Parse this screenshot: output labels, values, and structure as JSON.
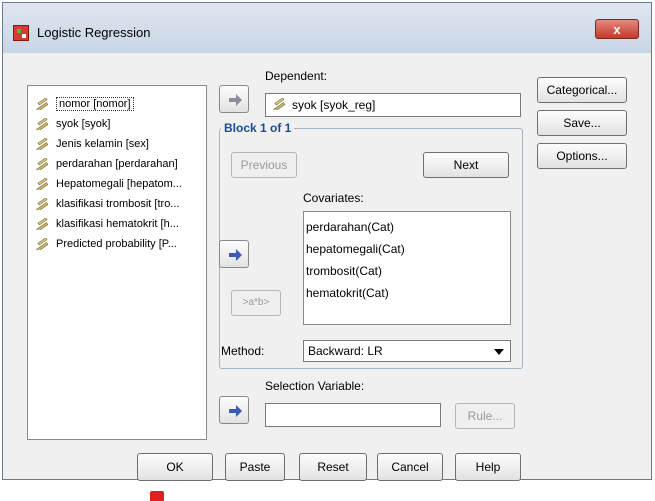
{
  "window": {
    "title": "Logistic Regression",
    "close_glyph": "x"
  },
  "variables": [
    {
      "label": "nomor [nomor]",
      "selected": true
    },
    {
      "label": "syok [syok]"
    },
    {
      "label": "Jenis kelamin [sex]"
    },
    {
      "label": "perdarahan  [perdarahan]"
    },
    {
      "label": "Hepatomegali [hepatom..."
    },
    {
      "label": "klasifikasi trombosit [tro..."
    },
    {
      "label": "klasifikasi hematokrit [h..."
    },
    {
      "label": "Predicted probability [P..."
    }
  ],
  "dependent": {
    "label": "Dependent:",
    "value": "syok [syok_reg]"
  },
  "block": {
    "title": "Block 1 of 1",
    "previous": "Previous",
    "next": "Next",
    "covariates_label": "Covariates:",
    "covariates": [
      "perdarahan(Cat)",
      "hepatomegali(Cat)",
      "trombosit(Cat)",
      "hematokrit(Cat)"
    ],
    "interaction_button": ">a*b>"
  },
  "method": {
    "label": "Method:",
    "value": "Backward: LR"
  },
  "selection": {
    "label": "Selection Variable:",
    "value": "",
    "rule_button": "Rule..."
  },
  "side_buttons": {
    "categorical": "Categorical...",
    "save": "Save...",
    "options": "Options..."
  },
  "bottom_buttons": {
    "ok": "OK",
    "paste": "Paste",
    "reset": "Reset",
    "cancel": "Cancel",
    "help": "Help"
  },
  "colors": {
    "accent": "#1b4a9c",
    "arrow": "#3b5bb5"
  },
  "icons": [
    "pencil-ruler-icon",
    "right-arrow-icon",
    "dropdown-caret-icon",
    "spss-app-icon"
  ]
}
